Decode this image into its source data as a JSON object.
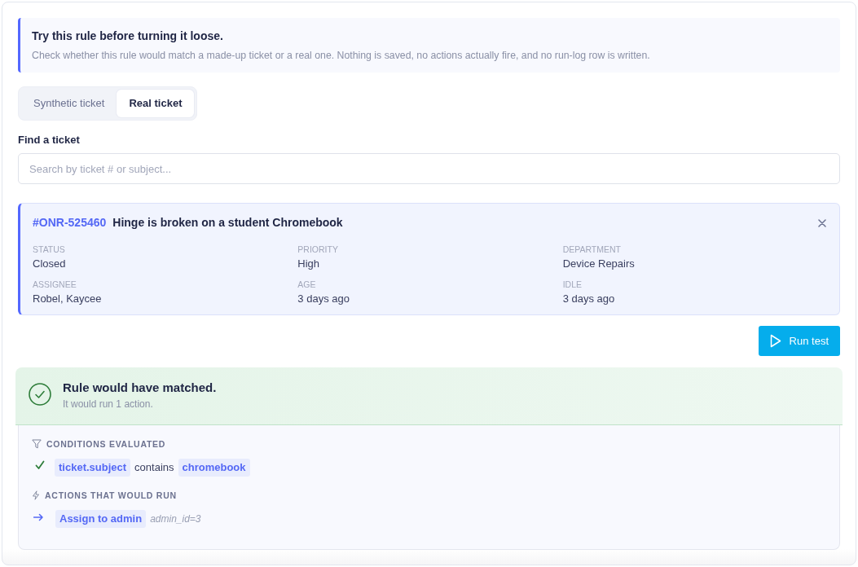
{
  "notice": {
    "title": "Try this rule before turning it loose.",
    "text": "Check whether this rule would match a made-up ticket or a real one. Nothing is saved, no actions actually fire, and no run-log row is written."
  },
  "mode_tabs": [
    {
      "label": "Synthetic ticket",
      "selected": false
    },
    {
      "label": "Real ticket",
      "selected": true
    }
  ],
  "search": {
    "label": "Find a ticket",
    "placeholder": "Search by ticket # or subject..."
  },
  "ticket": {
    "number": "#ONR-525460",
    "subject": "Hinge is broken on a student Chromebook",
    "fields": [
      {
        "label": "STATUS",
        "value": "Closed"
      },
      {
        "label": "PRIORITY",
        "value": "High"
      },
      {
        "label": "DEPARTMENT",
        "value": "Device Repairs"
      },
      {
        "label": "ASSIGNEE",
        "value": "Robel, Kaycee"
      },
      {
        "label": "AGE",
        "value": "3 days ago"
      },
      {
        "label": "IDLE",
        "value": "3 days ago"
      }
    ]
  },
  "run_button": {
    "label": "Run test"
  },
  "result": {
    "matched": true,
    "title": "Rule would have matched.",
    "subtitle": "It would run 1 action.",
    "sections": [
      {
        "kind": "conditions",
        "title": "CONDITIONS EVALUATED",
        "items": [
          {
            "passed": true,
            "field": "ticket.subject",
            "operator": "contains",
            "value": "chromebook"
          }
        ]
      },
      {
        "kind": "actions",
        "title": "ACTIONS THAT WOULD RUN",
        "items": [
          {
            "name": "Assign to admin",
            "params": "admin_id=3"
          }
        ]
      }
    ]
  }
}
